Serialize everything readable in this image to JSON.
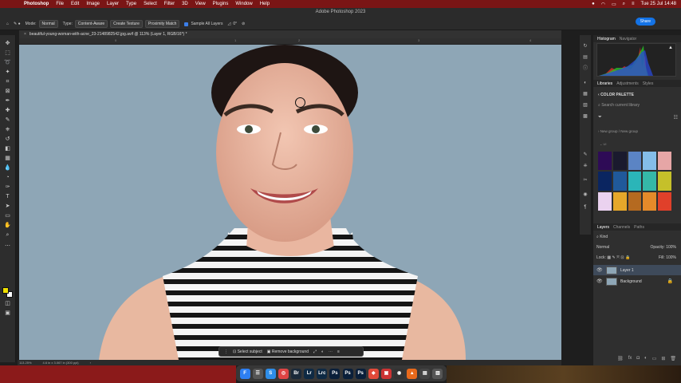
{
  "menubar": {
    "app": "Photoshop",
    "items": [
      "File",
      "Edit",
      "Image",
      "Layer",
      "Type",
      "Select",
      "Filter",
      "3D",
      "View",
      "Plugins",
      "Window",
      "Help"
    ],
    "datetime": "Tue 25 Jul  14:48"
  },
  "window": {
    "title": "Adobe Photoshop 2023"
  },
  "options": {
    "mode_label": "Mode:",
    "mode_value": "Normal",
    "type_label": "Type:",
    "type_options": [
      "Content-Aware",
      "Create Texture",
      "Proximity Match"
    ],
    "sample_all_layers": "Sample All Layers",
    "angle": "0°",
    "share": "Share"
  },
  "document": {
    "tab_title": "beautiful-young-woman-with-acne_23-2148982542.jpg.avif @ 113% (Layer 1, RGB/16*) *",
    "zoom": "113.25%",
    "dims": "4.6 in x 3.067 in (300 ppi)"
  },
  "ruler_marks": [
    "0",
    "1",
    "2",
    "3",
    "4"
  ],
  "context_bar": {
    "select_subject": "Select subject",
    "remove_background": "Remove background"
  },
  "panels": {
    "top_tabs": [
      "Histogram",
      "Navigator"
    ],
    "mid_tabs": [
      "Libraries",
      "Adjustments",
      "Styles"
    ],
    "library_name": "COLOR PALETTE",
    "search_placeholder": "Search current library",
    "new_group": "New group / New group",
    "sub_label": "UI",
    "swatches": [
      "#2e0b56",
      "#1a1a2e",
      "#5b84c4",
      "#84bde8",
      "#e6a6a6",
      "#0a2560",
      "#20599a",
      "#2bb5b8",
      "#35b8a8",
      "#c5c02a",
      "#ead2ef",
      "#e6a72a",
      "#b56a20",
      "#e58a2a",
      "#e0402a"
    ],
    "layer_tabs": [
      "Layers",
      "Channels",
      "Paths"
    ],
    "kind": "Kind",
    "blend_mode": "Normal",
    "opacity_label": "Opacity:",
    "opacity": "100%",
    "lock_label": "Lock:",
    "fill_label": "Fill:",
    "fill": "100%",
    "layers": [
      "Layer 1",
      "Background"
    ]
  },
  "dock_apps": [
    {
      "label": "F",
      "color": "#2e7ff2"
    },
    {
      "label": "☰",
      "color": "#555"
    },
    {
      "label": "S",
      "color": "#2e8de8"
    },
    {
      "label": "◎",
      "color": "#d44"
    },
    {
      "label": "Br",
      "color": "#1b2a3a"
    },
    {
      "label": "Lr",
      "color": "#0e2a44"
    },
    {
      "label": "Lrc",
      "color": "#0e2a44"
    },
    {
      "label": "Ps",
      "color": "#0a1f3a"
    },
    {
      "label": "Ps",
      "color": "#0a1f3a"
    },
    {
      "label": "Ps",
      "color": "#0a1f3a"
    },
    {
      "label": "◆",
      "color": "#e24a3a"
    },
    {
      "label": "▣",
      "color": "#c33"
    },
    {
      "label": "◉",
      "color": "#333"
    },
    {
      "label": "▲",
      "color": "#e8691b"
    },
    {
      "label": "▤",
      "color": "#444"
    },
    {
      "label": "▥",
      "color": "#555"
    }
  ]
}
